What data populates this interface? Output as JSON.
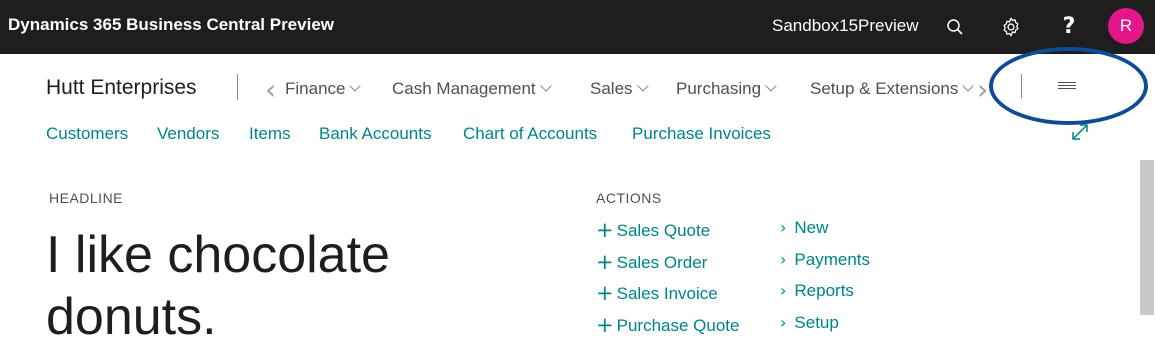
{
  "app": {
    "title": "Dynamics 365 Business Central Preview",
    "environment": "Sandbox15Preview",
    "avatar_initial": "R",
    "avatar_color": "#e5158a"
  },
  "header": {
    "company": "Hutt Enterprises",
    "nav": [
      {
        "label": "Finance"
      },
      {
        "label": "Cash Management"
      },
      {
        "label": "Sales"
      },
      {
        "label": "Purchasing"
      },
      {
        "label": "Setup & Extensions"
      }
    ]
  },
  "links": [
    "Customers",
    "Vendors",
    "Items",
    "Bank Accounts",
    "Chart of Accounts",
    "Purchase Invoices"
  ],
  "headline": {
    "label": "HEADLINE",
    "text": "I like chocolate donuts."
  },
  "actions": {
    "label": "ACTIONS",
    "create": [
      "Sales Quote",
      "Sales Order",
      "Sales Invoice",
      "Purchase Quote"
    ],
    "groups": [
      "New",
      "Payments",
      "Reports",
      "Setup"
    ]
  },
  "colors": {
    "accent": "#008489",
    "topbar": "#1e1e1e",
    "highlight": "#0f4c95"
  }
}
